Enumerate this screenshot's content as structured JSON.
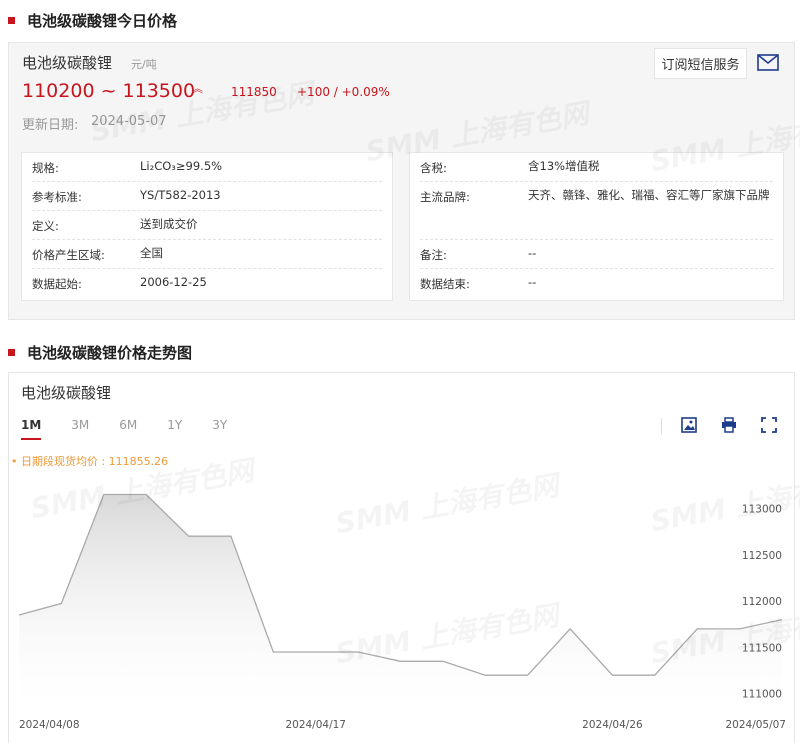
{
  "section1": {
    "title": "电池级碳酸锂今日价格"
  },
  "card": {
    "name": "电池级碳酸锂",
    "unit": "元/吨",
    "price_range": "110200 ~ 113500",
    "average": "111850",
    "change": "+100 / +0.09%",
    "update_label": "更新日期:",
    "update_date": "2024-05-07",
    "subscribe_label": "订阅短信服务",
    "left_rows": [
      {
        "key": "规格:",
        "value": "Li₂CO₃≥99.5%"
      },
      {
        "key": "参考标准:",
        "value": "YS/T582-2013"
      },
      {
        "key": "定义:",
        "value": "送到成交价"
      },
      {
        "key": "价格产生区域:",
        "value": "全国"
      },
      {
        "key": "数据起始:",
        "value": "2006-12-25"
      }
    ],
    "right_rows": [
      {
        "key": "含税:",
        "value": "含13%增值税"
      },
      {
        "key": "主流品牌:",
        "value": "天齐、赣锋、雅化、瑞福、容汇等厂家旗下品牌"
      },
      {
        "key": "备注:",
        "value": "--"
      },
      {
        "key": "数据结束:",
        "value": "--"
      }
    ]
  },
  "section2": {
    "title": "电池级碳酸锂价格走势图"
  },
  "chart_card": {
    "name": "电池级碳酸锂",
    "tabs": [
      "1M",
      "3M",
      "6M",
      "1Y",
      "3Y"
    ],
    "active_tab": "1M",
    "avg_label": "• 日期段现货均价 : 111855.26"
  },
  "watermark": "SMM 上海有色网",
  "colors": {
    "accent": "#c8151d",
    "avg": "#f09a38",
    "line": "#aaaaaa"
  },
  "icons": [
    "mail-icon",
    "image-download-icon",
    "print-icon",
    "fullscreen-icon",
    "price-up-arrow-icon"
  ],
  "chart_data": {
    "type": "area",
    "x": [
      "2024/04/08",
      "2024/04/09",
      "2024/04/10",
      "2024/04/11",
      "2024/04/12",
      "2024/04/15",
      "2024/04/16",
      "2024/04/17",
      "2024/04/18",
      "2024/04/19",
      "2024/04/22",
      "2024/04/23",
      "2024/04/24",
      "2024/04/25",
      "2024/04/26",
      "2024/04/29",
      "2024/04/30",
      "2024/05/06",
      "2024/05/07"
    ],
    "values": [
      111850,
      111975,
      113150,
      113150,
      112700,
      112700,
      111450,
      111450,
      111450,
      111350,
      111350,
      111200,
      111200,
      111700,
      111200,
      111200,
      111700,
      111700,
      111800
    ],
    "x_tick_labels": [
      "2024/04/08",
      "2024/04/17",
      "2024/04/26",
      "2024/05/07"
    ],
    "x_tick_index": [
      0,
      7,
      14,
      18
    ],
    "y_ticks": [
      111000,
      111500,
      112000,
      112500,
      113000
    ],
    "ylim": [
      110900,
      113350
    ],
    "grid": false,
    "title": "",
    "xlabel": "",
    "ylabel": ""
  }
}
